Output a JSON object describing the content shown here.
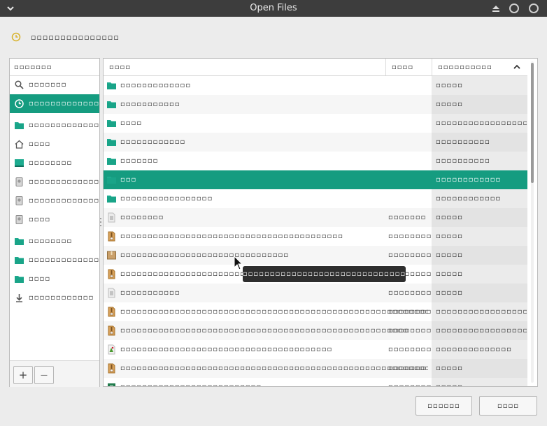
{
  "window": {
    "title": "Open Files"
  },
  "header": {
    "recent_label": "▫▫▫▫▫▫▫▫▫▫▫▫▫▫▫"
  },
  "sidebar": {
    "heading": "▫▫▫▫▫▫▫",
    "items": [
      {
        "icon": "search-icon",
        "label": "▫▫▫▫▫▫▫"
      },
      {
        "icon": "clock-icon",
        "label": "▫▫▫▫▫▫▫▫▫▫▫▫▫▫▫▫"
      },
      {
        "icon": "folder-icon",
        "label": "▫▫▫▫▫▫▫▫▫▫▫▫▫▫▫▫▫▫▫▫"
      },
      {
        "icon": "home-icon",
        "label": "▫▫▫▫"
      },
      {
        "icon": "desktop-icon",
        "label": "▫▫▫▫▫▫▫▫"
      },
      {
        "icon": "drive-icon",
        "label": "▫▫▫▫▫▫▫▫▫▫▫▫▫▫"
      },
      {
        "icon": "drive-icon",
        "label": "▫▫▫▫▫▫▫▫▫▫▫▫▫▫▫▫"
      },
      {
        "icon": "drive-icon",
        "label": "▫▫▫▫"
      },
      {
        "icon": "folder-icon",
        "label": "▫▫▫▫▫▫▫▫"
      },
      {
        "icon": "folder-icon",
        "label": "▫▫▫▫▫▫▫▫▫▫▫▫▫▫▫▫▫▫▫▫"
      },
      {
        "icon": "folder-icon",
        "label": "▫▫▫▫"
      },
      {
        "icon": "download-icon",
        "label": "▫▫▫▫▫▫▫▫▫▫▫▫"
      }
    ],
    "add_label": "+",
    "remove_label": "—"
  },
  "files": {
    "columns": {
      "name": "▫▫▫▫",
      "size": "▫▫▫▫",
      "modified": "▫▫▫▫▫▫▫▫▫▫"
    },
    "rows": [
      {
        "icon": "folder-icon",
        "name": "▫▫▫▫▫▫▫▫▫▫▫▫▫",
        "size": "",
        "modified": "▫▫▫▫▫"
      },
      {
        "icon": "folder-icon",
        "name": "▫▫▫▫▫▫▫▫▫▫▫",
        "size": "",
        "modified": "▫▫▫▫▫"
      },
      {
        "icon": "folder-icon",
        "name": "▫▫▫▫",
        "size": "",
        "modified": "▫▫▫▫▫▫▫▫▫▫▫▫▫▫▫▫▫▫▫▫▫▫▫"
      },
      {
        "icon": "folder-icon",
        "name": "▫▫▫▫▫▫▫▫▫▫▫▫",
        "size": "",
        "modified": "▫▫▫▫▫▫▫▫▫▫"
      },
      {
        "icon": "folder-icon",
        "name": "▫▫▫▫▫▫▫",
        "size": "",
        "modified": "▫▫▫▫▫▫▫▫▫▫"
      },
      {
        "icon": "folder-icon",
        "name": "▫▫▫",
        "size": "",
        "modified": "▫▫▫▫▫▫▫▫▫▫▫▫"
      },
      {
        "icon": "folder-icon",
        "name": "▫▫▫▫▫▫▫▫▫▫▫▫▫▫▫▫▫",
        "size": "",
        "modified": "▫▫▫▫▫▫▫▫▫▫▫▫"
      },
      {
        "icon": "text-file-icon",
        "name": "▫▫▫▫▫▫▫▫",
        "size": "▫▫▫▫▫▫▫",
        "modified": "▫▫▫▫▫"
      },
      {
        "icon": "archive-icon",
        "name": "▫▫▫▫▫▫▫▫▫▫▫▫▫▫▫▫▫▫▫▫▫▫▫▫▫▫▫▫▫▫▫▫▫▫▫▫▫▫▫▫▫",
        "size": "▫▫▫▫▫▫▫▫",
        "modified": "▫▫▫▫▫"
      },
      {
        "icon": "package-icon",
        "name": "▫▫▫▫▫▫▫▫▫▫▫▫▫▫▫▫▫▫▫▫▫▫▫▫▫▫▫▫▫▫▫",
        "size": "▫▫▫▫▫▫▫▫",
        "modified": "▫▫▫▫▫"
      },
      {
        "icon": "archive-icon",
        "name": "▫▫▫▫▫▫▫▫▫▫▫▫▫▫▫▫▫▫▫▫▫▫▫▫▫▫▫▫▫▫▫▫▫▫▫▫▫▫▫▫▫▫",
        "size": "▫▫▫▫▫▫▫▫",
        "modified": "▫▫▫▫▫"
      },
      {
        "icon": "text-file-icon",
        "name": "▫▫▫▫▫▫▫▫▫▫▫",
        "size": "▫▫▫▫▫▫▫▫",
        "modified": "▫▫▫▫▫"
      },
      {
        "icon": "archive-icon",
        "name": "▫▫▫▫▫▫▫▫▫▫▫▫▫▫▫▫▫▫▫▫▫▫▫▫▫▫▫▫▫▫▫▫▫▫▫▫▫▫▫▫▫▫▫▫▫▫▫▫▫▫▫▫▫▫▫▫▫",
        "size": "▫▫▫▫▫▫▫▫",
        "modified": "▫▫▫▫▫▫▫▫▫▫▫▫▫▫▫▫▫▫▫▫▫▫▫"
      },
      {
        "icon": "archive-icon",
        "name": "▫▫▫▫▫▫▫▫▫▫▫▫▫▫▫▫▫▫▫▫▫▫▫▫▫▫▫▫▫▫▫▫▫▫▫▫▫▫▫▫▫▫▫▫▫▫▫▫▫▫▫▫▫",
        "size": "▫▫▫▫▫▫▫▫",
        "modified": "▫▫▫▫▫▫▫▫▫▫▫▫▫▫▫▫▫▫▫▫▫▫▫"
      },
      {
        "icon": "image-file-icon",
        "name": "▫▫▫▫▫▫▫▫▫▫▫▫▫▫▫▫▫▫▫▫▫▫▫▫▫▫▫▫▫▫▫▫▫▫▫▫▫▫▫",
        "size": "▫▫▫▫▫▫▫▫",
        "modified": "▫▫▫▫▫▫▫▫▫▫▫▫▫▫"
      },
      {
        "icon": "archive-icon",
        "name": "▫▫▫▫▫▫▫▫▫▫▫▫▫▫▫▫▫▫▫▫▫▫▫▫▫▫▫▫▫▫▫▫▫▫▫▫▫▫▫▫▫▫▫▫▫▫▫▫▫▫▫▫▫▫▫▫▫",
        "size": "▫▫▫▫▫▫▫",
        "modified": "▫▫▫▫▫"
      },
      {
        "icon": "spreadsheet-file-icon",
        "name": "▫▫▫▫▫▫▫▫▫▫▫▫▫▫▫▫▫▫▫▫▫▫▫▫▫▫",
        "size": "▫▫▫▫▫▫▫▫",
        "modified": "▫▫▫▫▫"
      }
    ]
  },
  "tooltip": {
    "text": "▫▫▫▫▫▫▫▫▫▫▫▫▫▫▫▫▫▫▫▫▫▫▫▫▫▫▫▫▫▫▫▫▫▫▫▫▫▫▫▫▫▫▫▫▫▫▫▫▫▫▫▫▫▫"
  },
  "buttons": {
    "cancel": "▫▫▫▫▫▫",
    "open": "▫▫▫▫"
  },
  "colors": {
    "accent": "#159c80",
    "folder": "#1dab8f",
    "titlebar": "#3d3d3d",
    "recent_icon": "#d8b22a"
  }
}
